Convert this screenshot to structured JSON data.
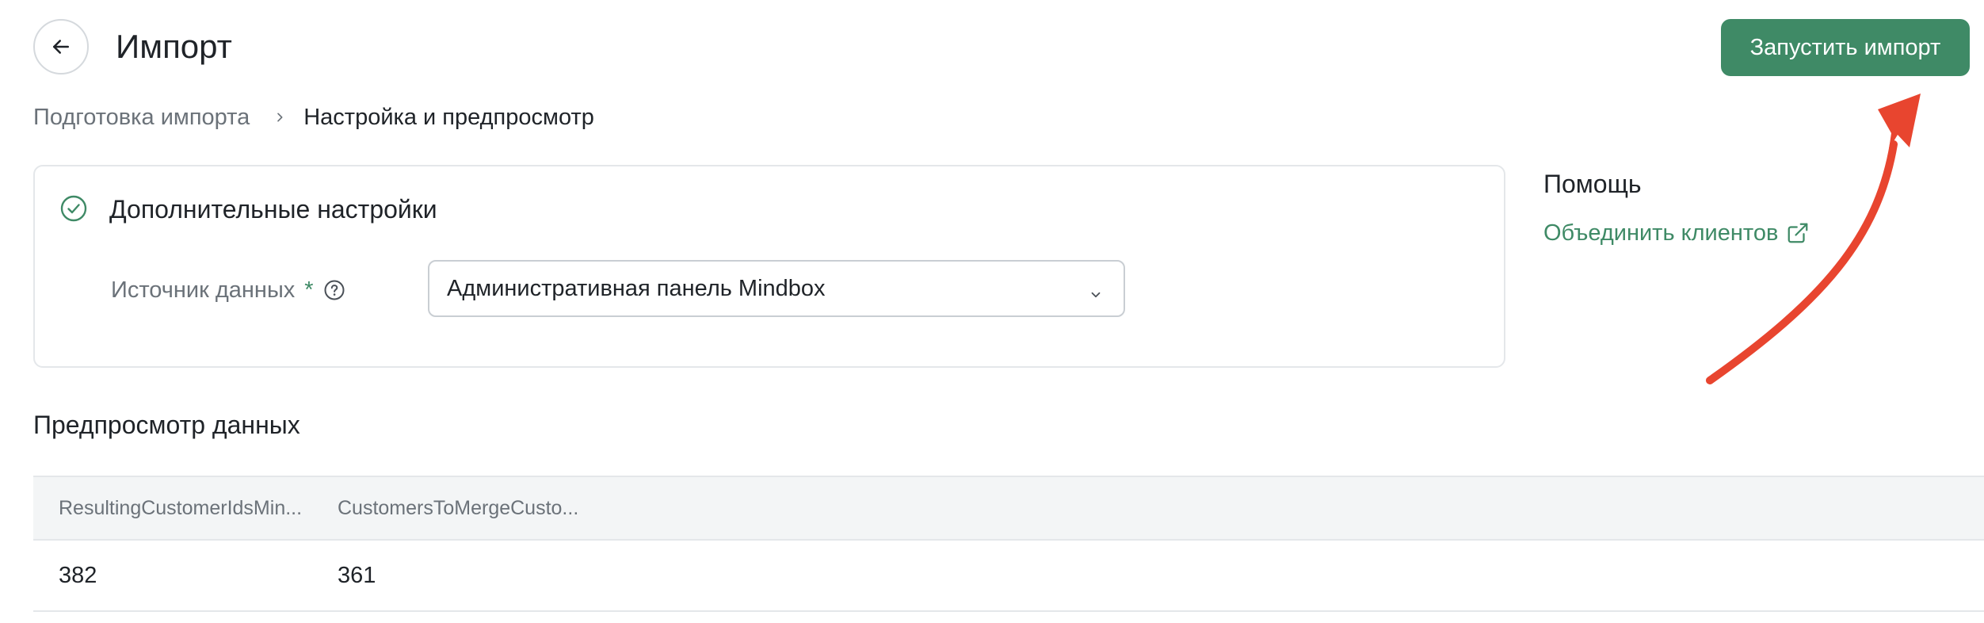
{
  "header": {
    "title": "Импорт",
    "primary_action": "Запустить импорт"
  },
  "breadcrumb": {
    "items": [
      "Подготовка импорта",
      "Настройка и предпросмотр"
    ]
  },
  "settings": {
    "title": "Дополнительные настройки",
    "data_source_label": "Источник данных",
    "required_mark": "*",
    "data_source_value": "Административная панель Mindbox"
  },
  "help": {
    "title": "Помощь",
    "link": "Объединить клиентов"
  },
  "preview": {
    "title": "Предпросмотр данных",
    "columns": [
      "ResultingCustomerIdsMin...",
      "CustomersToMergeCusto..."
    ],
    "rows": [
      [
        "382",
        "361"
      ]
    ]
  },
  "colors": {
    "accent": "#3f8a66",
    "annotation": "#e8452f"
  }
}
